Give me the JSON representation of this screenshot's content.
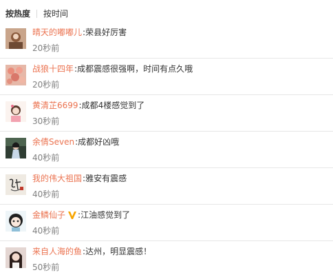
{
  "sort": {
    "hot_label": "按热度",
    "time_label": "按时间"
  },
  "separator": ":",
  "comments": [
    {
      "user": "晴天的嘟嘟儿",
      "text": "荣县好厉害",
      "time": "20秒前",
      "verified": false,
      "avatar_color": "#b7876a"
    },
    {
      "user": "战狼十四年",
      "text": "成都震感很强啊，时间有点久哦",
      "time": "20秒前",
      "verified": false,
      "avatar_color": "#d99a8a"
    },
    {
      "user": "黄清芷6699",
      "text": "成都4楼感觉到了",
      "time": "30秒前",
      "verified": false,
      "avatar_color": "#f2e6e0"
    },
    {
      "user": "余倩Seven",
      "text": "成都好凶哦",
      "time": "40秒前",
      "verified": false,
      "avatar_color": "#3c4a3a"
    },
    {
      "user": "我的伟大祖国",
      "text": "雅安有震感",
      "time": "40秒前",
      "verified": false,
      "avatar_color": "#e9e4dc"
    },
    {
      "user": "金鳞仙子",
      "text": "江油感觉到了",
      "time": "40秒前",
      "verified": true,
      "avatar_color": "#e6f0f5"
    },
    {
      "user": "来自人海的鱼",
      "text": "达州，明显震感！",
      "time": "50秒前",
      "verified": false,
      "avatar_color": "#d9c7c2"
    }
  ],
  "colors": {
    "username": "#eb7350",
    "time": "#808080",
    "verified_badge": "#f7a500"
  }
}
